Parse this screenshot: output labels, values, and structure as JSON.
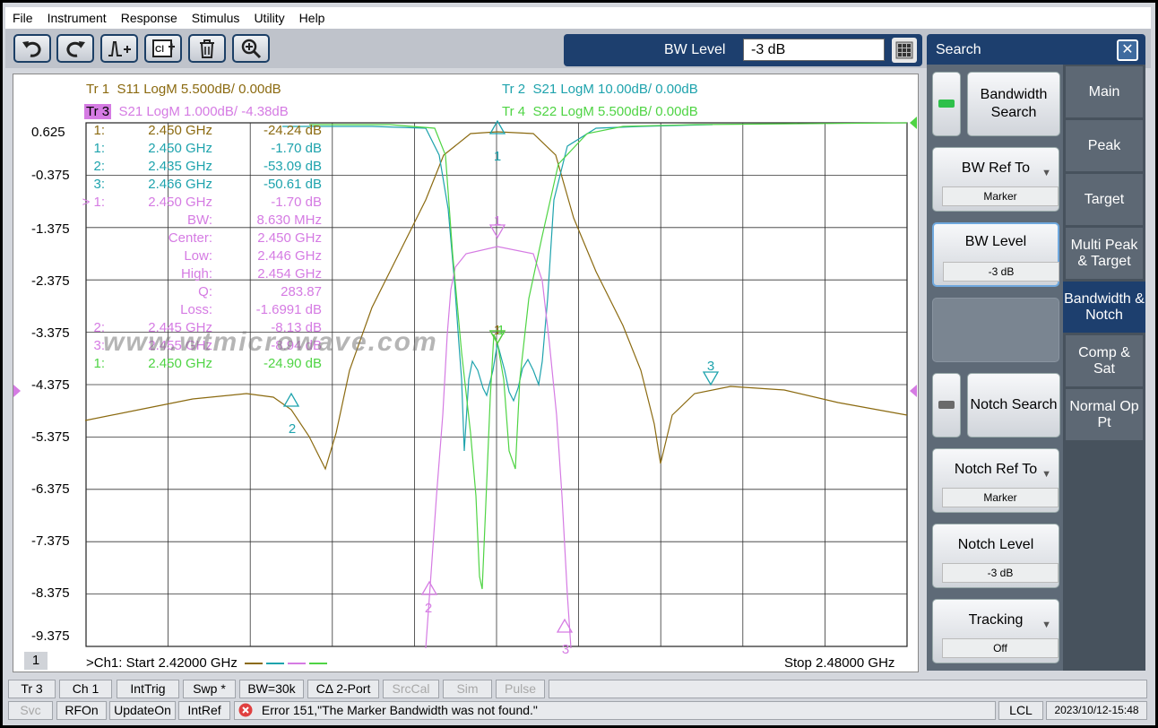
{
  "menu": [
    "File",
    "Instrument",
    "Response",
    "Stimulus",
    "Utility",
    "Help"
  ],
  "toolbar": {
    "icons": [
      "undo-icon",
      "redo-icon",
      "marker-icon",
      "cal-icon",
      "trash-icon",
      "zoom-icon"
    ]
  },
  "bw_entry": {
    "label": "BW Level",
    "value": "-3 dB"
  },
  "trace_headers": [
    {
      "id": "Tr 1",
      "desc": "S11 LogM 5.500dB/  0.00dB",
      "color": "#8b6a10"
    },
    {
      "id": "Tr 2",
      "desc": "S21 LogM 10.00dB/  0.00dB",
      "color": "#1ea3ad"
    },
    {
      "id": "Tr 3",
      "desc": "S21 LogM 1.000dB/  -4.38dB",
      "color": "#d57be3"
    },
    {
      "id": "Tr 4",
      "desc": "S22 LogM 5.500dB/  0.00dB",
      "color": "#4fd444"
    }
  ],
  "y_labels": [
    "0.625",
    "-0.375",
    "-1.375",
    "-2.375",
    "-3.375",
    "-4.375",
    "-5.375",
    "-6.375",
    "-7.375",
    "-8.375",
    "-9.375"
  ],
  "markers": [
    {
      "idx": "1:",
      "freq": "2.450  GHz",
      "val": "-24.24 dB",
      "color": "#8b6a10"
    },
    {
      "idx": "1:",
      "freq": "2.450  GHz",
      "val": "-1.70 dB",
      "color": "#1ea3ad"
    },
    {
      "idx": "2:",
      "freq": "2.435  GHz",
      "val": "-53.09 dB",
      "color": "#1ea3ad"
    },
    {
      "idx": "3:",
      "freq": "2.466  GHz",
      "val": "-50.61 dB",
      "color": "#1ea3ad"
    },
    {
      "idx": "> 1:",
      "freq": "2.450  GHz",
      "val": "-1.70 dB",
      "color": "#d57be3"
    },
    {
      "idx": "",
      "freq": "BW:",
      "val": "8.630 MHz",
      "color": "#d57be3"
    },
    {
      "idx": "",
      "freq": "Center:",
      "val": "2.450 GHz",
      "color": "#d57be3"
    },
    {
      "idx": "",
      "freq": "Low:",
      "val": "2.446 GHz",
      "color": "#d57be3"
    },
    {
      "idx": "",
      "freq": "High:",
      "val": "2.454 GHz",
      "color": "#d57be3"
    },
    {
      "idx": "",
      "freq": "Q:",
      "val": "283.87",
      "color": "#d57be3"
    },
    {
      "idx": "",
      "freq": "Loss:",
      "val": "-1.6991 dB",
      "color": "#d57be3"
    },
    {
      "idx": "2:",
      "freq": "2.445  GHz",
      "val": "-8.13 dB",
      "color": "#d57be3"
    },
    {
      "idx": "3:",
      "freq": "2.455  GHz",
      "val": "-8.94 dB",
      "color": "#d57be3"
    },
    {
      "idx": "1:",
      "freq": "2.450  GHz",
      "val": "-24.90 dB",
      "color": "#4fd444"
    }
  ],
  "watermark": "www.wtmicrowave.com",
  "chart_data": {
    "type": "line",
    "x_start_ghz": 2.42,
    "x_stop_ghz": 2.48,
    "ylabel_scale": "Tr 3 dB",
    "ylim": [
      -9.375,
      0.625
    ],
    "grid": true,
    "series": [
      {
        "name": "Tr 1 S11",
        "color": "#8b6a10"
      },
      {
        "name": "Tr 2 S21",
        "color": "#1ea3ad"
      },
      {
        "name": "Tr 3 S21",
        "color": "#d57be3"
      },
      {
        "name": "Tr 4 S22",
        "color": "#4fd444"
      }
    ],
    "marker_labels": [
      "1",
      "2",
      "3",
      "1",
      "2",
      "3",
      "1",
      "1"
    ]
  },
  "channel": {
    "number": "1",
    "start": ">Ch1:  Start  2.42000 GHz",
    "stop": "Stop  2.48000 GHz"
  },
  "side_panel": {
    "title": "Search",
    "bandwidth_search": "Bandwidth Search",
    "bw_ref_to": "BW Ref To",
    "bw_ref_val": "Marker",
    "bw_level": "BW Level",
    "bw_level_val": "-3 dB",
    "notch_search": "Notch Search",
    "notch_ref_to": "Notch Ref To",
    "notch_ref_val": "Marker",
    "notch_level": "Notch Level",
    "notch_level_val": "-3 dB",
    "tracking": "Tracking",
    "tracking_val": "Off",
    "colors": {
      "led_on": "#2ec04a",
      "led_off": "#6a6a6a"
    }
  },
  "tabs": [
    "Main",
    "Peak",
    "Target",
    "Multi Peak & Target",
    "Bandwidth & Notch",
    "Comp & Sat",
    "Normal Op Pt"
  ],
  "status_row1": [
    "Tr 3",
    "Ch 1",
    "IntTrig",
    "Swp *",
    "BW=30k",
    "CΔ 2-Port",
    "SrcCal",
    "Sim",
    "Pulse"
  ],
  "status_row2": {
    "svc": "Svc",
    "rfon": "RFOn",
    "update": "UpdateOn",
    "intref": "IntRef",
    "error": "Error 151,\"The Marker Bandwidth was not found.\"",
    "lcl": "LCL",
    "datetime": "2023/10/12-15:48"
  }
}
